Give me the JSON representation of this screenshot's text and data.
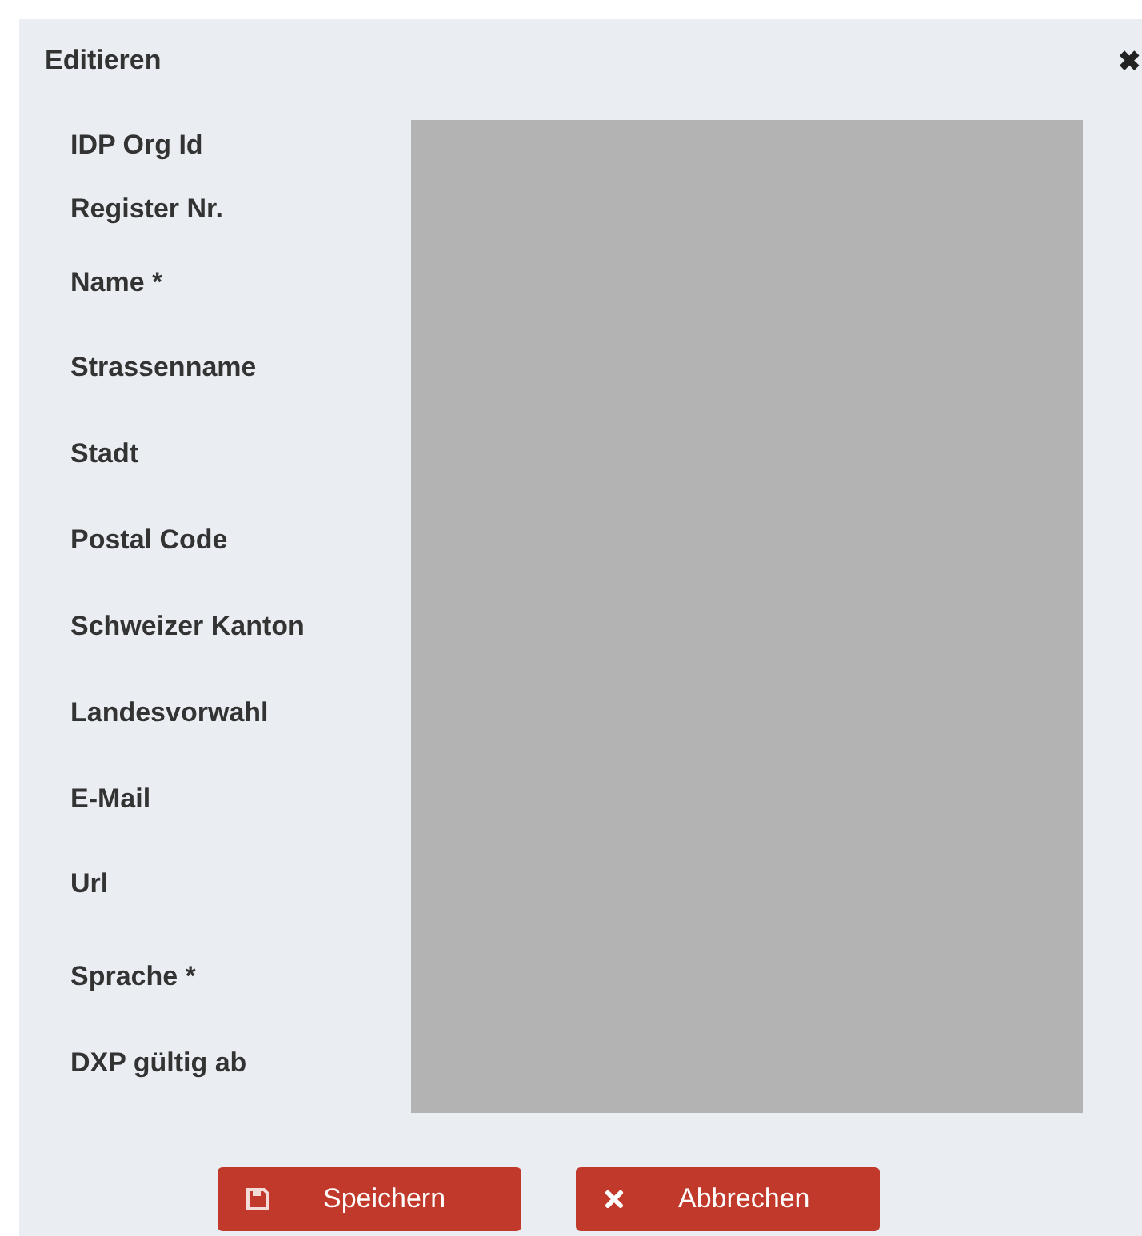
{
  "dialog": {
    "title": "Editieren",
    "close": "✖"
  },
  "fields": [
    {
      "label": "IDP Org Id"
    },
    {
      "label": "Register Nr."
    },
    {
      "label": "Name *"
    },
    {
      "label": "Strassenname"
    },
    {
      "label": "Stadt"
    },
    {
      "label": "Postal Code"
    },
    {
      "label": "Schweizer Kanton"
    },
    {
      "label": "Landesvorwahl"
    },
    {
      "label": "E-Mail"
    },
    {
      "label": "Url"
    },
    {
      "label": "Sprache *"
    },
    {
      "label": "DXP gültig ab"
    }
  ],
  "buttons": [
    {
      "label": "Speichern",
      "kind": "save"
    },
    {
      "label": "Abbrechen",
      "kind": "cancel"
    }
  ]
}
